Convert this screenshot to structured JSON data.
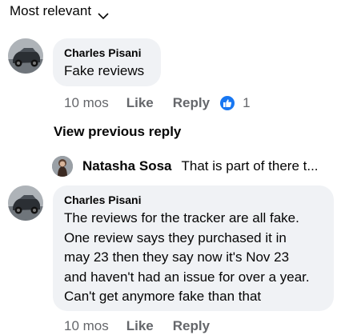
{
  "sort": {
    "label": "Most relevant",
    "icon": "chevron-down-icon"
  },
  "comments": [
    {
      "author": "Charles Pisani",
      "text": "Fake reviews",
      "time": "10 mos",
      "like_label": "Like",
      "reply_label": "Reply",
      "reaction_icon": "thumbs-up-icon",
      "reaction_count": "1"
    },
    {
      "author": "Charles Pisani",
      "lines": [
        "The reviews for the tracker are all fake.",
        "One review says they purchased it in",
        "may 23 then they say now it's Nov 23",
        "and haven't had an issue for over a year.",
        "Can't get anymore fake than that"
      ],
      "time": "10 mos",
      "like_label": "Like",
      "reply_label": "Reply"
    }
  ],
  "view_previous_reply": "View previous reply",
  "reply_preview": {
    "author": "Natasha Sosa",
    "text": "That is part of there t..."
  },
  "colors": {
    "bubble_bg": "#f0f2f5",
    "secondary_text": "#65676b",
    "reaction_blue": "#1877f2"
  }
}
